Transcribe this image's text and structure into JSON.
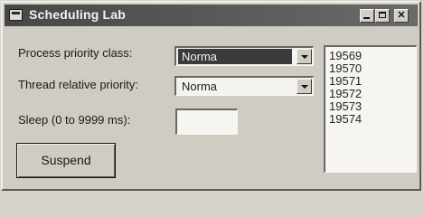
{
  "window": {
    "title": "Scheduling Lab"
  },
  "form": {
    "process_priority_label": "Process priority class:",
    "process_priority_value": "Norma",
    "thread_priority_label": "Thread relative priority:",
    "thread_priority_value": "Norma",
    "sleep_label": "Sleep (0 to 9999 ms):",
    "sleep_value": "",
    "suspend_button": "Suspend"
  },
  "list": {
    "items": [
      "19569",
      "19570",
      "19571",
      "19572",
      "19573",
      "19574"
    ]
  },
  "icons": {
    "app": "app-window-icon",
    "minimize": "minimize-icon",
    "maximize": "maximize-icon",
    "close": "close-icon",
    "dropdown": "chevron-down-icon"
  }
}
